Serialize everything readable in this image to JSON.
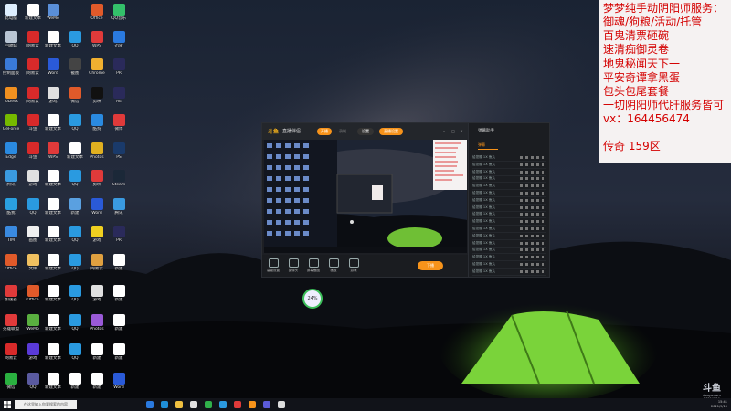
{
  "promo": {
    "lines": [
      "梦梦纯手动阴阳师服务：",
      "御魂/狗粮/活动/托管",
      "百鬼清票砸碗",
      "速清痴御灵卷",
      "地鬼秘闻天下一",
      "平安奇谭拿黑蛋",
      "包头包尾套餐",
      "一切阴阳师代肝服务皆可",
      "vx：164456474",
      "",
      "传奇 159区"
    ]
  },
  "app": {
    "logo": "斗鱼",
    "title": "直播伴侣",
    "tab_start": "开播",
    "tab_record": "录制",
    "btn_settings": "设置",
    "btn_live": "直播设置",
    "tools": [
      "高级设置",
      "摄像头",
      "屏幕截图",
      "画板",
      "游戏"
    ],
    "stop_live": "下播"
  },
  "chat": {
    "title": "弹幕助手",
    "tab": "弹幕",
    "rows": [
      "给您赠 1X 鱼丸",
      "给您赠 1X 鱼丸",
      "给您赠 1X 鱼丸",
      "给您赠 1X 鱼丸",
      "给您赠 1X 鱼丸",
      "给您赠 1X 鱼丸",
      "给您赠 1X 鱼丸",
      "给您赠 1X 鱼丸",
      "给您赠 1X 鱼丸",
      "给您赠 1X 鱼丸",
      "给您赠 1X 鱼丸",
      "给您赠 1X 鱼丸",
      "给您赠 1X 鱼丸",
      "给您赠 1X 鱼丸",
      "给您赠 1X 鱼丸",
      "给您赠 1X 鱼丸",
      "给您赠 1X 鱼丸"
    ]
  },
  "fps_widget": {
    "value": "24%"
  },
  "watermark": {
    "brand": "斗鱼",
    "domain": "douyu.com",
    "date": "2021/9/19"
  },
  "taskbar": {
    "search_placeholder": "在这里输入你要搜索的内容",
    "time": "15:41",
    "date": "2021/9/19"
  },
  "desktop_icons": [
    {
      "label": "此电脑",
      "color": "#ddeeff"
    },
    {
      "label": "新建文本",
      "color": "#ffffff"
    },
    {
      "label": "WeMo",
      "color": "#5a8fd8"
    },
    {
      "label": "Office",
      "color": "#e05a2a"
    },
    {
      "label": "QQ音乐",
      "color": "#33c06a"
    },
    {
      "label": "回收站",
      "color": "#b9c5d4"
    },
    {
      "label": "网易云",
      "color": "#d82a2a"
    },
    {
      "label": "新建文本",
      "color": "#ffffff"
    },
    {
      "label": "QQ",
      "color": "#2a9ae0"
    },
    {
      "label": "WPS",
      "color": "#e03a3a"
    },
    {
      "label": "迅雷",
      "color": "#2a7ae0"
    },
    {
      "label": "控制面板",
      "color": "#3a7ad8"
    },
    {
      "label": "网易云",
      "color": "#d82a2a"
    },
    {
      "label": "Word",
      "color": "#2a5ad8"
    },
    {
      "label": "截图",
      "color": "#444"
    },
    {
      "label": "Chrome",
      "color": "#f0b030"
    },
    {
      "label": "PR",
      "color": "#2a2a5a"
    },
    {
      "label": "ToDesk",
      "color": "#f09020"
    },
    {
      "label": "网易云",
      "color": "#d82a2a"
    },
    {
      "label": "游戏",
      "color": "#e0e0e0"
    },
    {
      "label": "微信",
      "color": "#e05a2a"
    },
    {
      "label": "剪映",
      "color": "#111"
    },
    {
      "label": "AE",
      "color": "#2a2a5a"
    },
    {
      "label": "GeForce",
      "color": "#76b900"
    },
    {
      "label": "斗鱼",
      "color": "#d82a2a"
    },
    {
      "label": "新建文本",
      "color": "#ffffff"
    },
    {
      "label": "QQ",
      "color": "#2a9ae0"
    },
    {
      "label": "酷狗",
      "color": "#2a8ae0"
    },
    {
      "label": "微博",
      "color": "#e03a3a"
    },
    {
      "label": "Edge",
      "color": "#2a8ae0"
    },
    {
      "label": "斗鱼",
      "color": "#d82a2a"
    },
    {
      "label": "WPS",
      "color": "#e03a3a"
    },
    {
      "label": "新建文本",
      "color": "#ffffff"
    },
    {
      "label": "Photos",
      "color": "#e0b020"
    },
    {
      "label": "PS",
      "color": "#1a3a6a"
    },
    {
      "label": "腾讯",
      "color": "#3a9ae0"
    },
    {
      "label": "游戏",
      "color": "#e0e0e0"
    },
    {
      "label": "新建文本",
      "color": "#ffffff"
    },
    {
      "label": "QQ",
      "color": "#2a9ae0"
    },
    {
      "label": "剪映",
      "color": "#e03a3a"
    },
    {
      "label": "Steam",
      "color": "#1b2838"
    },
    {
      "label": "酷我",
      "color": "#2aa0e0"
    },
    {
      "label": "QQ",
      "color": "#2a9ae0"
    },
    {
      "label": "新建文本",
      "color": "#ffffff"
    },
    {
      "label": "新建",
      "color": "#5aa0e0"
    },
    {
      "label": "Word",
      "color": "#2a5ad8"
    },
    {
      "label": "腾讯",
      "color": "#3a9ae0"
    },
    {
      "label": "TIM",
      "color": "#3a8ae0"
    },
    {
      "label": "画图",
      "color": "#f0f0f0"
    },
    {
      "label": "新建文本",
      "color": "#ffffff"
    },
    {
      "label": "QQ",
      "color": "#2a9ae0"
    },
    {
      "label": "游戏",
      "color": "#f0d020"
    },
    {
      "label": "PR",
      "color": "#2a2a5a"
    },
    {
      "label": "Office",
      "color": "#e05a2a"
    },
    {
      "label": "文件",
      "color": "#f0c060"
    },
    {
      "label": "新建文本",
      "color": "#ffffff"
    },
    {
      "label": "QQ",
      "color": "#2a9ae0"
    },
    {
      "label": "网易云",
      "color": "#e0a040"
    },
    {
      "label": "新建",
      "color": "#ffffff"
    },
    {
      "label": "加速器",
      "color": "#e03a3a"
    },
    {
      "label": "Office",
      "color": "#e05a2a"
    },
    {
      "label": "新建文本",
      "color": "#ffffff"
    },
    {
      "label": "QQ",
      "color": "#2a9ae0"
    },
    {
      "label": "游戏",
      "color": "#e0e0e0"
    },
    {
      "label": "新建",
      "color": "#ffffff"
    },
    {
      "label": "英雄联盟",
      "color": "#e03a3a"
    },
    {
      "label": "WeMo",
      "color": "#5ab040"
    },
    {
      "label": "新建文本",
      "color": "#ffffff"
    },
    {
      "label": "QQ",
      "color": "#2a9ae0"
    },
    {
      "label": "Photos",
      "color": "#9a5ad8"
    },
    {
      "label": "新建",
      "color": "#ffffff"
    },
    {
      "label": "网易云",
      "color": "#d82a2a"
    },
    {
      "label": "游戏",
      "color": "#5a3ad8"
    },
    {
      "label": "新建文本",
      "color": "#ffffff"
    },
    {
      "label": "QQ",
      "color": "#2a9ae0"
    },
    {
      "label": "新建",
      "color": "#ffffff"
    },
    {
      "label": "新建",
      "color": "#ffffff"
    },
    {
      "label": "微信",
      "color": "#2ab040"
    },
    {
      "label": "QQ",
      "color": "#5a5aa0"
    },
    {
      "label": "新建文本",
      "color": "#ffffff"
    },
    {
      "label": "新建",
      "color": "#ffffff"
    },
    {
      "label": "新建",
      "color": "#ffffff"
    },
    {
      "label": "Word",
      "color": "#2a5ad8"
    }
  ],
  "colors": {
    "promo_text": "#d40000",
    "accent": "#f7931a",
    "tent": "#7ad33a"
  }
}
